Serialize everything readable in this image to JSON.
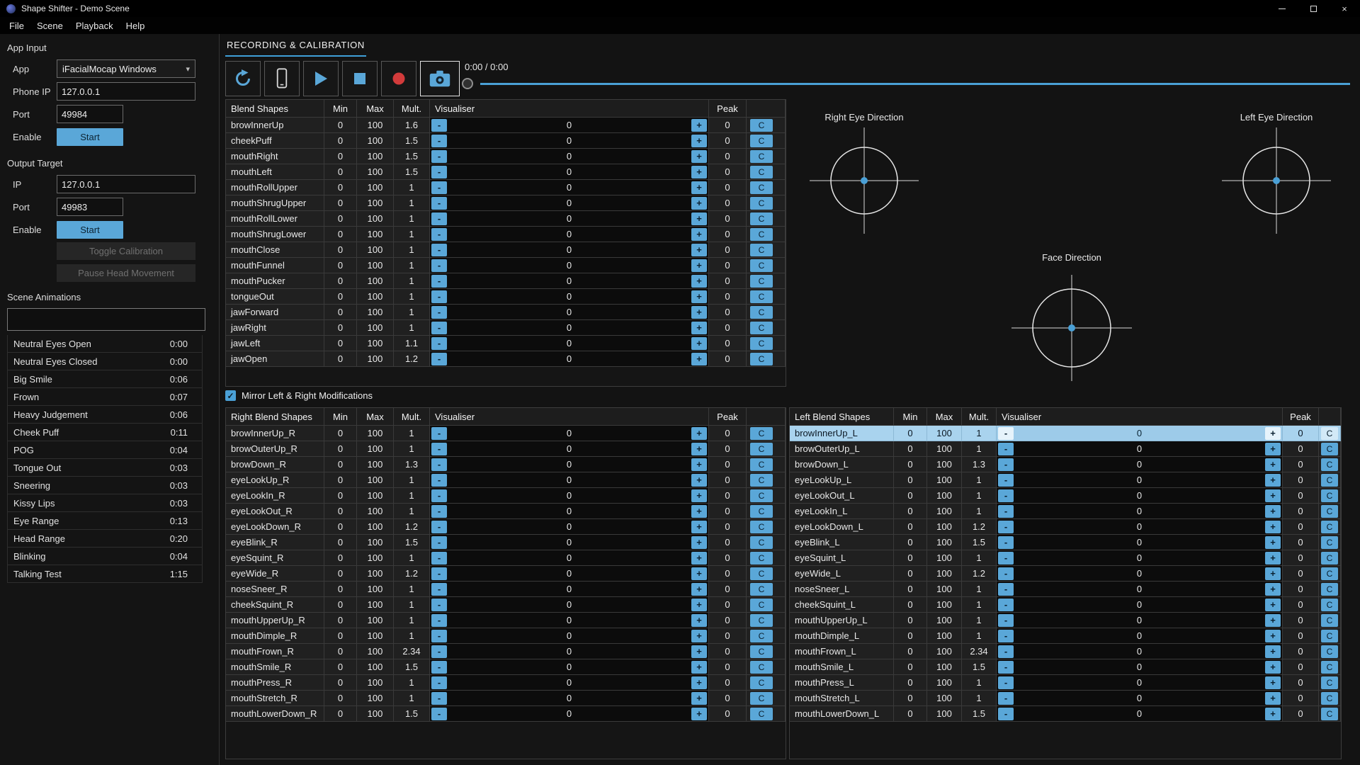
{
  "titlebar": {
    "title": "Shape Shifter - Demo Scene",
    "minimize_glyph": "–",
    "close_glyph": "×"
  },
  "menu": {
    "items": [
      "File",
      "Scene",
      "Playback",
      "Help"
    ]
  },
  "glyphs": {
    "caret": "▾",
    "check": "✓"
  },
  "colors": {
    "accent": "#5aa7d8",
    "record_red": "#d23b3b",
    "selection_blue": "#a9d3ee",
    "tab_underline": "#3f9fd8"
  },
  "sidebar": {
    "app_input": {
      "title": "App Input",
      "app_label": "App",
      "app_value": "iFacialMocap Windows",
      "phone_ip_label": "Phone IP",
      "phone_ip_value": "127.0.0.1",
      "port_label": "Port",
      "port_value": "49984",
      "enable_label": "Enable",
      "start_label": "Start"
    },
    "output_target": {
      "title": "Output Target",
      "ip_label": "IP",
      "ip_value": "127.0.0.1",
      "port_label": "Port",
      "port_value": "49983",
      "enable_label": "Enable",
      "start_label": "Start",
      "toggle_calibration_label": "Toggle Calibration",
      "pause_head_label": "Pause Head Movement"
    },
    "scene_animations": {
      "title": "Scene Animations",
      "items": [
        {
          "name": "Neutral Eyes Open",
          "time": "0:00"
        },
        {
          "name": "Neutral Eyes Closed",
          "time": "0:00"
        },
        {
          "name": "Big Smile",
          "time": "0:06"
        },
        {
          "name": "Frown",
          "time": "0:07"
        },
        {
          "name": "Heavy Judgement",
          "time": "0:06"
        },
        {
          "name": "Cheek Puff",
          "time": "0:11"
        },
        {
          "name": "POG",
          "time": "0:04"
        },
        {
          "name": "Tongue Out",
          "time": "0:03"
        },
        {
          "name": "Sneering",
          "time": "0:03"
        },
        {
          "name": "Kissy Lips",
          "time": "0:03"
        },
        {
          "name": "Eye Range",
          "time": "0:13"
        },
        {
          "name": "Head Range",
          "time": "0:20"
        },
        {
          "name": "Blinking",
          "time": "0:04"
        },
        {
          "name": "Talking Test",
          "time": "1:15"
        }
      ]
    }
  },
  "main": {
    "tab": "RECORDING & CALIBRATION",
    "transport": {
      "time": "0:00 / 0:00"
    },
    "mirror_checkbox": "Mirror Left & Right Modifications",
    "direction_widgets": {
      "right_eye": "Right Eye Direction",
      "left_eye": "Left Eye Direction",
      "face": "Face Direction"
    }
  },
  "tables": {
    "headers": {
      "min": "Min",
      "max": "Max",
      "mult": "Mult.",
      "visualiser": "Visualiser",
      "peak": "Peak"
    },
    "buttons": {
      "minus": "-",
      "plus": "+",
      "c": "C"
    },
    "blend": {
      "title": "Blend Shapes",
      "rows": [
        {
          "name": "browInnerUp",
          "min": 0,
          "max": 100,
          "mult": 1.6,
          "vis": 0,
          "peak": 0
        },
        {
          "name": "cheekPuff",
          "min": 0,
          "max": 100,
          "mult": 1.5,
          "vis": 0,
          "peak": 0
        },
        {
          "name": "mouthRight",
          "min": 0,
          "max": 100,
          "mult": 1.5,
          "vis": 0,
          "peak": 0
        },
        {
          "name": "mouthLeft",
          "min": 0,
          "max": 100,
          "mult": 1.5,
          "vis": 0,
          "peak": 0
        },
        {
          "name": "mouthRollUpper",
          "min": 0,
          "max": 100,
          "mult": 1,
          "vis": 0,
          "peak": 0
        },
        {
          "name": "mouthShrugUpper",
          "min": 0,
          "max": 100,
          "mult": 1,
          "vis": 0,
          "peak": 0
        },
        {
          "name": "mouthRollLower",
          "min": 0,
          "max": 100,
          "mult": 1,
          "vis": 0,
          "peak": 0
        },
        {
          "name": "mouthShrugLower",
          "min": 0,
          "max": 100,
          "mult": 1,
          "vis": 0,
          "peak": 0
        },
        {
          "name": "mouthClose",
          "min": 0,
          "max": 100,
          "mult": 1,
          "vis": 0,
          "peak": 0
        },
        {
          "name": "mouthFunnel",
          "min": 0,
          "max": 100,
          "mult": 1,
          "vis": 0,
          "peak": 0
        },
        {
          "name": "mouthPucker",
          "min": 0,
          "max": 100,
          "mult": 1,
          "vis": 0,
          "peak": 0
        },
        {
          "name": "tongueOut",
          "min": 0,
          "max": 100,
          "mult": 1,
          "vis": 0,
          "peak": 0
        },
        {
          "name": "jawForward",
          "min": 0,
          "max": 100,
          "mult": 1,
          "vis": 0,
          "peak": 0
        },
        {
          "name": "jawRight",
          "min": 0,
          "max": 100,
          "mult": 1,
          "vis": 0,
          "peak": 0
        },
        {
          "name": "jawLeft",
          "min": 0,
          "max": 100,
          "mult": 1.1,
          "vis": 0,
          "peak": 0
        },
        {
          "name": "jawOpen",
          "min": 0,
          "max": 100,
          "mult": 1.2,
          "vis": 0,
          "peak": 0
        }
      ]
    },
    "right": {
      "title": "Right Blend Shapes",
      "rows": [
        {
          "name": "browInnerUp_R",
          "min": 0,
          "max": 100,
          "mult": 1,
          "vis": 0,
          "peak": 0
        },
        {
          "name": "browOuterUp_R",
          "min": 0,
          "max": 100,
          "mult": 1,
          "vis": 0,
          "peak": 0
        },
        {
          "name": "browDown_R",
          "min": 0,
          "max": 100,
          "mult": 1.3,
          "vis": 0,
          "peak": 0
        },
        {
          "name": "eyeLookUp_R",
          "min": 0,
          "max": 100,
          "mult": 1,
          "vis": 0,
          "peak": 0
        },
        {
          "name": "eyeLookIn_R",
          "min": 0,
          "max": 100,
          "mult": 1,
          "vis": 0,
          "peak": 0
        },
        {
          "name": "eyeLookOut_R",
          "min": 0,
          "max": 100,
          "mult": 1,
          "vis": 0,
          "peak": 0
        },
        {
          "name": "eyeLookDown_R",
          "min": 0,
          "max": 100,
          "mult": 1.2,
          "vis": 0,
          "peak": 0
        },
        {
          "name": "eyeBlink_R",
          "min": 0,
          "max": 100,
          "mult": 1.5,
          "vis": 0,
          "peak": 0
        },
        {
          "name": "eyeSquint_R",
          "min": 0,
          "max": 100,
          "mult": 1,
          "vis": 0,
          "peak": 0
        },
        {
          "name": "eyeWide_R",
          "min": 0,
          "max": 100,
          "mult": 1.2,
          "vis": 0,
          "peak": 0
        },
        {
          "name": "noseSneer_R",
          "min": 0,
          "max": 100,
          "mult": 1,
          "vis": 0,
          "peak": 0
        },
        {
          "name": "cheekSquint_R",
          "min": 0,
          "max": 100,
          "mult": 1,
          "vis": 0,
          "peak": 0
        },
        {
          "name": "mouthUpperUp_R",
          "min": 0,
          "max": 100,
          "mult": 1,
          "vis": 0,
          "peak": 0
        },
        {
          "name": "mouthDimple_R",
          "min": 0,
          "max": 100,
          "mult": 1,
          "vis": 0,
          "peak": 0
        },
        {
          "name": "mouthFrown_R",
          "min": 0,
          "max": 100,
          "mult": 2.34,
          "vis": 0,
          "peak": 0
        },
        {
          "name": "mouthSmile_R",
          "min": 0,
          "max": 100,
          "mult": 1.5,
          "vis": 0,
          "peak": 0
        },
        {
          "name": "mouthPress_R",
          "min": 0,
          "max": 100,
          "mult": 1,
          "vis": 0,
          "peak": 0
        },
        {
          "name": "mouthStretch_R",
          "min": 0,
          "max": 100,
          "mult": 1,
          "vis": 0,
          "peak": 0
        },
        {
          "name": "mouthLowerDown_R",
          "min": 0,
          "max": 100,
          "mult": 1.5,
          "vis": 0,
          "peak": 0
        }
      ]
    },
    "left": {
      "title": "Left Blend Shapes",
      "rows": [
        {
          "name": "browInnerUp_L",
          "min": 0,
          "max": 100,
          "mult": 1,
          "vis": 0,
          "peak": 0,
          "selected": true
        },
        {
          "name": "browOuterUp_L",
          "min": 0,
          "max": 100,
          "mult": 1,
          "vis": 0,
          "peak": 0
        },
        {
          "name": "browDown_L",
          "min": 0,
          "max": 100,
          "mult": 1.3,
          "vis": 0,
          "peak": 0
        },
        {
          "name": "eyeLookUp_L",
          "min": 0,
          "max": 100,
          "mult": 1,
          "vis": 0,
          "peak": 0
        },
        {
          "name": "eyeLookOut_L",
          "min": 0,
          "max": 100,
          "mult": 1,
          "vis": 0,
          "peak": 0
        },
        {
          "name": "eyeLookIn_L",
          "min": 0,
          "max": 100,
          "mult": 1,
          "vis": 0,
          "peak": 0
        },
        {
          "name": "eyeLookDown_L",
          "min": 0,
          "max": 100,
          "mult": 1.2,
          "vis": 0,
          "peak": 0
        },
        {
          "name": "eyeBlink_L",
          "min": 0,
          "max": 100,
          "mult": 1.5,
          "vis": 0,
          "peak": 0
        },
        {
          "name": "eyeSquint_L",
          "min": 0,
          "max": 100,
          "mult": 1,
          "vis": 0,
          "peak": 0
        },
        {
          "name": "eyeWide_L",
          "min": 0,
          "max": 100,
          "mult": 1.2,
          "vis": 0,
          "peak": 0
        },
        {
          "name": "noseSneer_L",
          "min": 0,
          "max": 100,
          "mult": 1,
          "vis": 0,
          "peak": 0
        },
        {
          "name": "cheekSquint_L",
          "min": 0,
          "max": 100,
          "mult": 1,
          "vis": 0,
          "peak": 0
        },
        {
          "name": "mouthUpperUp_L",
          "min": 0,
          "max": 100,
          "mult": 1,
          "vis": 0,
          "peak": 0
        },
        {
          "name": "mouthDimple_L",
          "min": 0,
          "max": 100,
          "mult": 1,
          "vis": 0,
          "peak": 0
        },
        {
          "name": "mouthFrown_L",
          "min": 0,
          "max": 100,
          "mult": 2.34,
          "vis": 0,
          "peak": 0
        },
        {
          "name": "mouthSmile_L",
          "min": 0,
          "max": 100,
          "mult": 1.5,
          "vis": 0,
          "peak": 0
        },
        {
          "name": "mouthPress_L",
          "min": 0,
          "max": 100,
          "mult": 1,
          "vis": 0,
          "peak": 0
        },
        {
          "name": "mouthStretch_L",
          "min": 0,
          "max": 100,
          "mult": 1,
          "vis": 0,
          "peak": 0
        },
        {
          "name": "mouthLowerDown_L",
          "min": 0,
          "max": 100,
          "mult": 1.5,
          "vis": 0,
          "peak": 0
        }
      ]
    }
  }
}
